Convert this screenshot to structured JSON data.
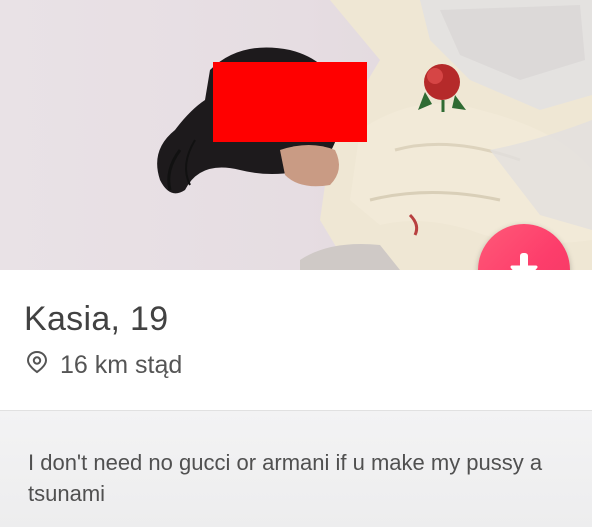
{
  "profile": {
    "name_age": "Kasia, 19",
    "distance": "16 km stąd",
    "bio": "I don't need no gucci or armani if u make my pussy a tsunami"
  },
  "icons": {
    "location": "location-pin-icon",
    "action": "arrow-down-icon"
  },
  "colors": {
    "accent": "#fd3d6b",
    "redaction": "#ff0000"
  }
}
